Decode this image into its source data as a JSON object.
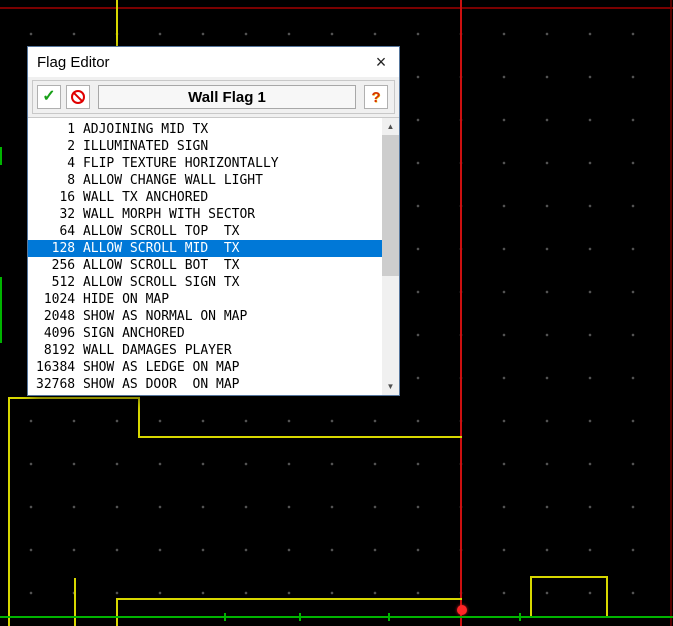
{
  "window": {
    "title": "Flag Editor",
    "close_glyph": "×"
  },
  "toolbar": {
    "ok_glyph": "✓",
    "field_value": "Wall Flag 1",
    "help_glyph": "?"
  },
  "scrollbar": {
    "up_glyph": "▲",
    "down_glyph": "▼"
  },
  "flag_list": {
    "selected_value": "128",
    "rows": [
      {
        "value": "1",
        "label": "ADJOINING MID TX",
        "selected": false
      },
      {
        "value": "2",
        "label": "ILLUMINATED SIGN",
        "selected": false
      },
      {
        "value": "4",
        "label": "FLIP TEXTURE HORIZONTALLY",
        "selected": false
      },
      {
        "value": "8",
        "label": "ALLOW CHANGE WALL LIGHT",
        "selected": false
      },
      {
        "value": "16",
        "label": "WALL TX ANCHORED",
        "selected": false
      },
      {
        "value": "32",
        "label": "WALL MORPH WITH SECTOR",
        "selected": false
      },
      {
        "value": "64",
        "label": "ALLOW SCROLL TOP  TX",
        "selected": false
      },
      {
        "value": "128",
        "label": "ALLOW SCROLL MID  TX",
        "selected": true
      },
      {
        "value": "256",
        "label": "ALLOW SCROLL BOT  TX",
        "selected": false
      },
      {
        "value": "512",
        "label": "ALLOW SCROLL SIGN TX",
        "selected": false
      },
      {
        "value": "1024",
        "label": "HIDE ON MAP",
        "selected": false
      },
      {
        "value": "2048",
        "label": "SHOW AS NORMAL ON MAP",
        "selected": false
      },
      {
        "value": "4096",
        "label": "SIGN ANCHORED",
        "selected": false
      },
      {
        "value": "8192",
        "label": "WALL DAMAGES PLAYER",
        "selected": false
      },
      {
        "value": "16384",
        "label": "SHOW AS LEDGE ON MAP",
        "selected": false
      },
      {
        "value": "32768",
        "label": "SHOW AS DOOR  ON MAP",
        "selected": false
      }
    ]
  },
  "colors": {
    "map_background": "#000000",
    "grid_dot": "#545454",
    "selection": "#0078d7",
    "wall_yellow": "#d8d800",
    "wall_green": "#00b400",
    "wall_red": "#cc1010",
    "wall_dark_red": "#7a0000",
    "vertex_red": "#ff2626"
  }
}
